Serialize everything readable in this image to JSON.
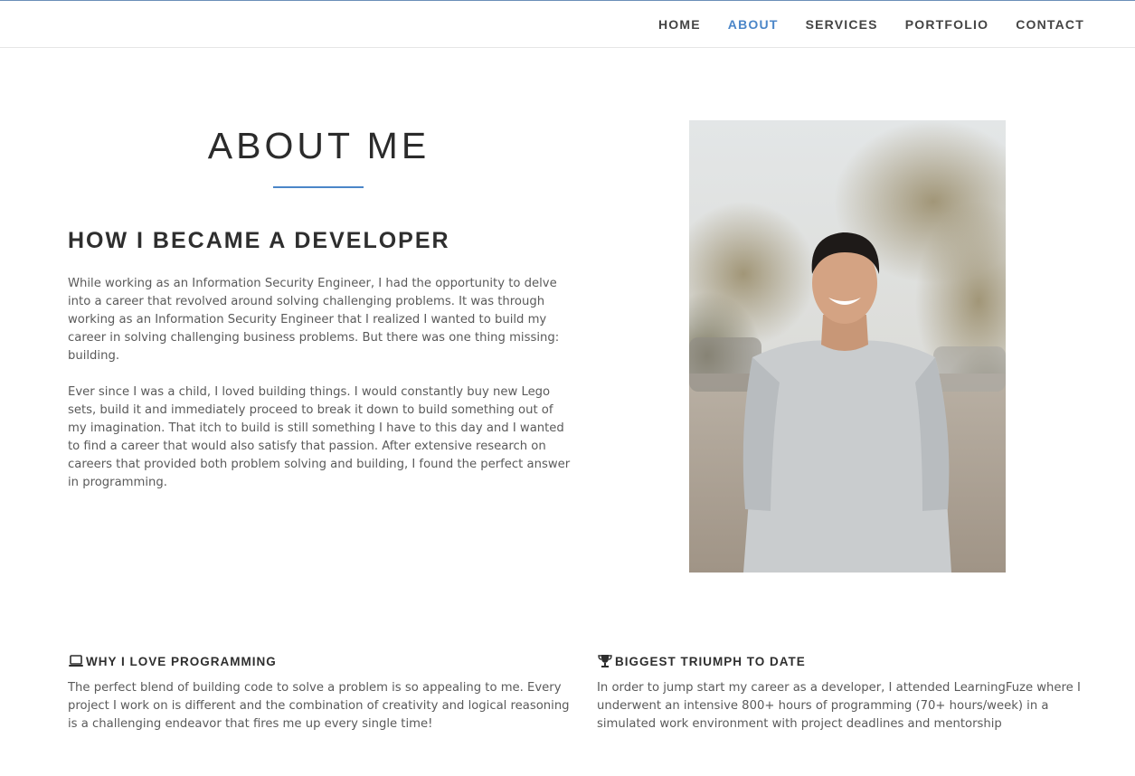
{
  "nav": {
    "items": [
      {
        "label": "HOME",
        "active": false
      },
      {
        "label": "ABOUT",
        "active": true
      },
      {
        "label": "SERVICES",
        "active": false
      },
      {
        "label": "PORTFOLIO",
        "active": false
      },
      {
        "label": "CONTACT",
        "active": false
      }
    ]
  },
  "about": {
    "title": "ABOUT ME",
    "heading": "HOW I BECAME A DEVELOPER",
    "paragraphs": [
      "While working as an Information Security Engineer, I had the opportunity to delve into a career that revolved around solving challenging problems. It was through working as an Information Security Engineer that I realized I wanted to build my career in solving challenging business problems. But there was one thing missing: building.",
      "Ever since I was a child, I loved building things. I would constantly buy new Lego sets, build it and immediately proceed to break it down to build something out of my imagination. That itch to build is still something I have to this day and I wanted to find a career that would also satisfy that passion. After extensive research on careers that provided both problem solving and building, I found the perfect answer in programming."
    ]
  },
  "features": [
    {
      "icon": "laptop-icon",
      "title": "WHY I LOVE PROGRAMMING",
      "text": "The perfect blend of building code to solve a problem is so appealing to me. Every project I work on is different and the combination of creativity and logical reasoning is a challenging endeavor that fires me up every single time!"
    },
    {
      "icon": "trophy-icon",
      "title": "BIGGEST TRIUMPH TO DATE",
      "text": "In order to jump start my career as a developer, I attended LearningFuze where I underwent an intensive 800+ hours of programming (70+ hours/week) in a simulated work environment with project deadlines and mentorship"
    }
  ],
  "colors": {
    "accent": "#4b86c8",
    "heading": "#2e2e2e",
    "body_text": "#5a5a5a"
  }
}
